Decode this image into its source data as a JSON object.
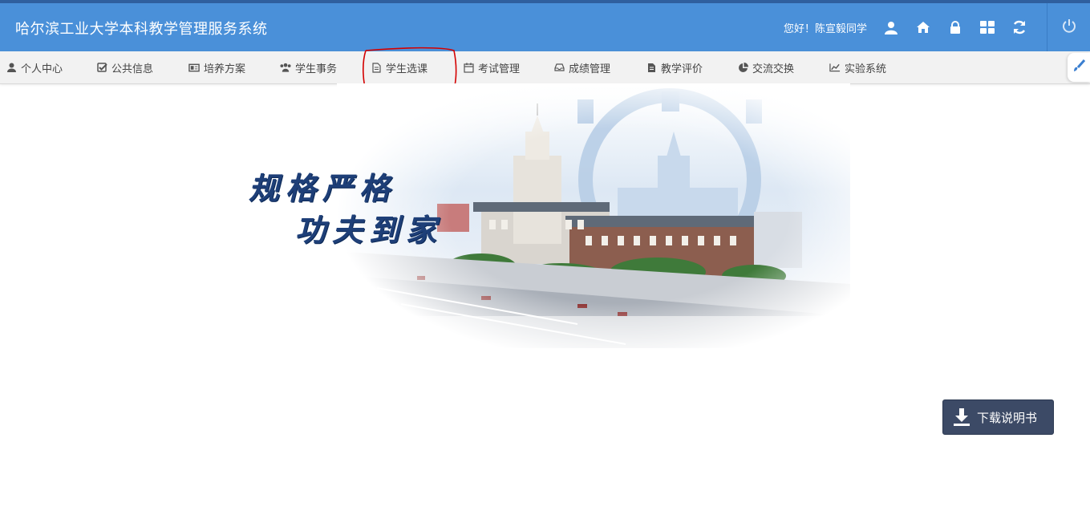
{
  "header": {
    "app_title": "哈尔滨工业大学本科教学管理服务系统",
    "greeting": "您好！陈宣毅同学",
    "icons": [
      "user-icon",
      "home-icon",
      "lock-icon",
      "grid-icon",
      "refresh-icon",
      "power-icon"
    ]
  },
  "nav": {
    "items": [
      {
        "label": "个人中心",
        "icon": "user-icon"
      },
      {
        "label": "公共信息",
        "icon": "checkbox-icon"
      },
      {
        "label": "培养方案",
        "icon": "newspaper-icon"
      },
      {
        "label": "学生事务",
        "icon": "users-icon"
      },
      {
        "label": "学生选课",
        "icon": "document-icon"
      },
      {
        "label": "考试管理",
        "icon": "calendar-icon"
      },
      {
        "label": "成绩管理",
        "icon": "inbox-icon"
      },
      {
        "label": "教学评价",
        "icon": "file-text-icon"
      },
      {
        "label": "交流交换",
        "icon": "pie-chart-icon"
      },
      {
        "label": "实验系统",
        "icon": "line-chart-icon"
      }
    ],
    "brush_icon": "brush-icon"
  },
  "banner": {
    "slogan_line1": "规格严格",
    "slogan_line2": "功夫到家"
  },
  "download": {
    "label": "下载说明书",
    "icon": "download-icon"
  },
  "colors": {
    "header_bg": "#4a90d9",
    "nav_bg": "#f2f2f2",
    "button_bg": "#3c4a66",
    "annotation": "#d40000"
  }
}
